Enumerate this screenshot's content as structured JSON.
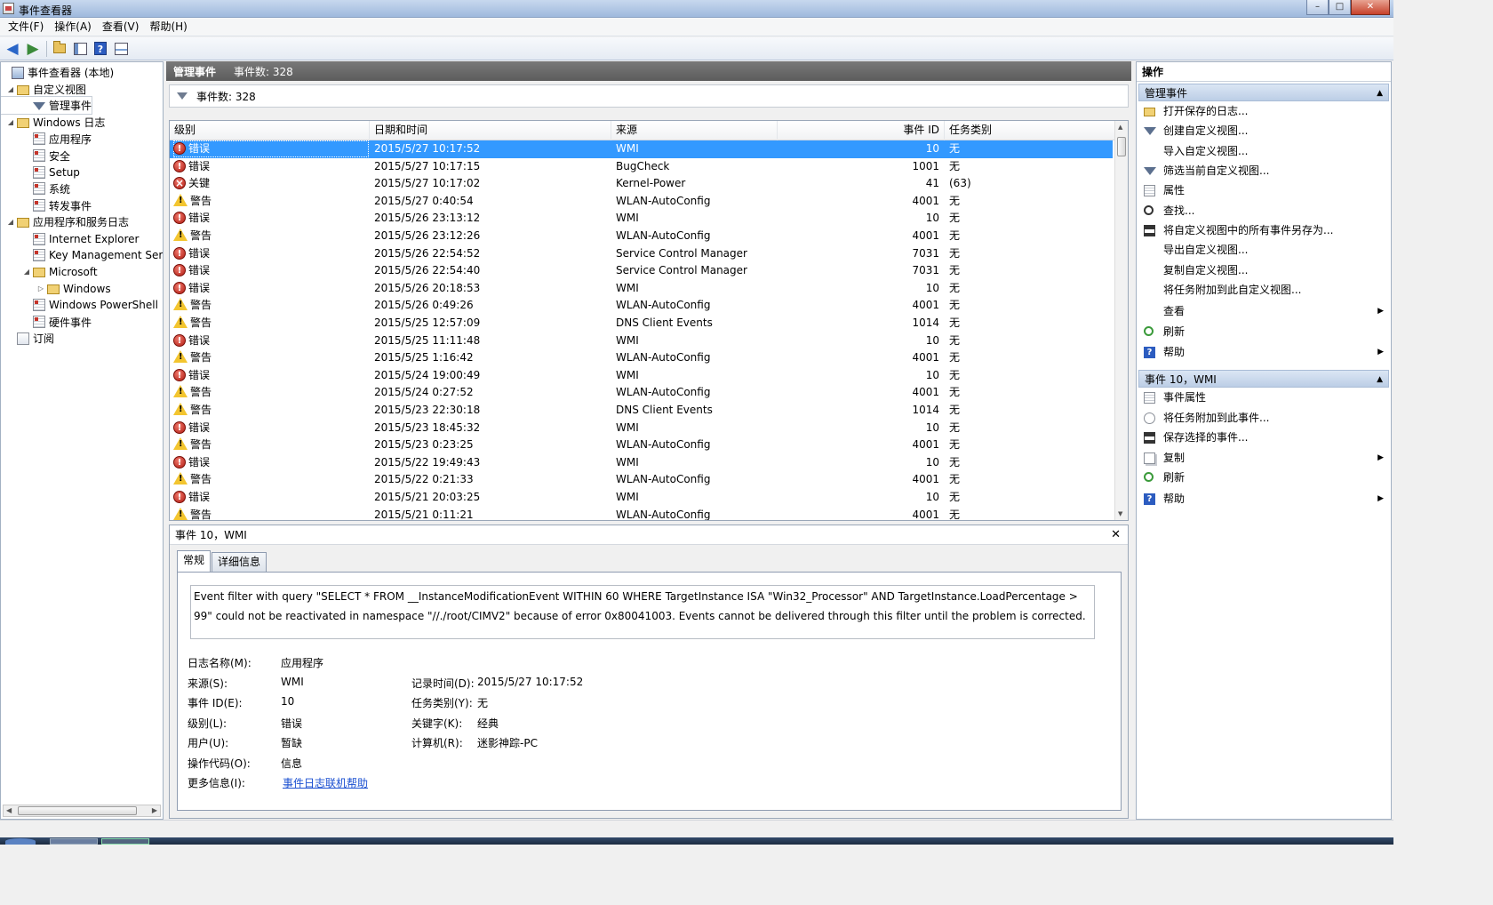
{
  "window": {
    "title": "事件查看器",
    "buttons": {
      "minimize": "–",
      "maximize": "□",
      "close": "✕"
    }
  },
  "menu": [
    {
      "label": "文件(F)"
    },
    {
      "label": "操作(A)"
    },
    {
      "label": "查看(V)"
    },
    {
      "label": "帮助(H)"
    }
  ],
  "toolbar": {
    "back_icon": "arrow-left",
    "forward_icon": "arrow-right",
    "help_glyph": "?"
  },
  "tree": {
    "items": [
      {
        "label": "事件查看器 (本地)",
        "icon": "computer-icon",
        "twisty": ""
      },
      {
        "label": "自定义视图",
        "icon": "folder-icon",
        "twisty": "◢"
      },
      {
        "label": "管理事件",
        "icon": "filter-icon",
        "twisty": ""
      },
      {
        "label": "Windows 日志",
        "icon": "folder-icon",
        "twisty": "◢"
      },
      {
        "label": "应用程序",
        "icon": "log-icon",
        "twisty": ""
      },
      {
        "label": "安全",
        "icon": "log-icon",
        "twisty": ""
      },
      {
        "label": "Setup",
        "icon": "log-icon",
        "twisty": ""
      },
      {
        "label": "系统",
        "icon": "log-icon",
        "twisty": ""
      },
      {
        "label": "转发事件",
        "icon": "log-icon",
        "twisty": ""
      },
      {
        "label": "应用程序和服务日志",
        "icon": "folder-icon",
        "twisty": "◢"
      },
      {
        "label": "Internet Explorer",
        "icon": "log-icon",
        "twisty": ""
      },
      {
        "label": "Key Management Serv",
        "icon": "log-icon",
        "twisty": ""
      },
      {
        "label": "Microsoft",
        "icon": "folder-icon",
        "twisty": "◢"
      },
      {
        "label": "Windows",
        "icon": "folder-icon",
        "twisty": "▷"
      },
      {
        "label": "Windows PowerShell",
        "icon": "log-icon",
        "twisty": ""
      },
      {
        "label": "硬件事件",
        "icon": "log-icon",
        "twisty": ""
      },
      {
        "label": "订阅",
        "icon": "subscription-icon",
        "twisty": ""
      }
    ],
    "scroll_thumb_glyph": "III"
  },
  "center": {
    "header_title": "管理事件",
    "header_count": "事件数: 328",
    "filter_text": "事件数: 328",
    "columns": [
      "级别",
      "日期和时间",
      "来源",
      "事件 ID",
      "任务类别"
    ],
    "rows": [
      {
        "level": "错误",
        "level_type": "info",
        "datetime": "2015/5/27 10:17:52",
        "source": "WMI",
        "event_id": "10",
        "task": "无"
      },
      {
        "level": "错误",
        "level_type": "error",
        "datetime": "2015/5/27 10:17:15",
        "source": "BugCheck",
        "event_id": "1001",
        "task": "无"
      },
      {
        "level": "关键",
        "level_type": "critical",
        "datetime": "2015/5/27 10:17:02",
        "source": "Kernel-Power",
        "event_id": "41",
        "task": "(63)"
      },
      {
        "level": "警告",
        "level_type": "warning",
        "datetime": "2015/5/27 0:40:54",
        "source": "WLAN-AutoConfig",
        "event_id": "4001",
        "task": "无"
      },
      {
        "level": "错误",
        "level_type": "error",
        "datetime": "2015/5/26 23:13:12",
        "source": "WMI",
        "event_id": "10",
        "task": "无"
      },
      {
        "level": "警告",
        "level_type": "warning",
        "datetime": "2015/5/26 23:12:26",
        "source": "WLAN-AutoConfig",
        "event_id": "4001",
        "task": "无"
      },
      {
        "level": "错误",
        "level_type": "error",
        "datetime": "2015/5/26 22:54:52",
        "source": "Service Control Manager",
        "event_id": "7031",
        "task": "无"
      },
      {
        "level": "错误",
        "level_type": "error",
        "datetime": "2015/5/26 22:54:40",
        "source": "Service Control Manager",
        "event_id": "7031",
        "task": "无"
      },
      {
        "level": "错误",
        "level_type": "error",
        "datetime": "2015/5/26 20:18:53",
        "source": "WMI",
        "event_id": "10",
        "task": "无"
      },
      {
        "level": "警告",
        "level_type": "warning",
        "datetime": "2015/5/26 0:49:26",
        "source": "WLAN-AutoConfig",
        "event_id": "4001",
        "task": "无"
      },
      {
        "level": "警告",
        "level_type": "warning",
        "datetime": "2015/5/25 12:57:09",
        "source": "DNS Client Events",
        "event_id": "1014",
        "task": "无"
      },
      {
        "level": "错误",
        "level_type": "error",
        "datetime": "2015/5/25 11:11:48",
        "source": "WMI",
        "event_id": "10",
        "task": "无"
      },
      {
        "level": "警告",
        "level_type": "warning",
        "datetime": "2015/5/25 1:16:42",
        "source": "WLAN-AutoConfig",
        "event_id": "4001",
        "task": "无"
      },
      {
        "level": "错误",
        "level_type": "error",
        "datetime": "2015/5/24 19:00:49",
        "source": "WMI",
        "event_id": "10",
        "task": "无"
      },
      {
        "level": "警告",
        "level_type": "warning",
        "datetime": "2015/5/24 0:27:52",
        "source": "WLAN-AutoConfig",
        "event_id": "4001",
        "task": "无"
      },
      {
        "level": "警告",
        "level_type": "warning",
        "datetime": "2015/5/23 22:30:18",
        "source": "DNS Client Events",
        "event_id": "1014",
        "task": "无"
      },
      {
        "level": "错误",
        "level_type": "error",
        "datetime": "2015/5/23 18:45:32",
        "source": "WMI",
        "event_id": "10",
        "task": "无"
      },
      {
        "level": "警告",
        "level_type": "warning",
        "datetime": "2015/5/23 0:23:25",
        "source": "WLAN-AutoConfig",
        "event_id": "4001",
        "task": "无"
      },
      {
        "level": "错误",
        "level_type": "error",
        "datetime": "2015/5/22 19:49:43",
        "source": "WMI",
        "event_id": "10",
        "task": "无"
      },
      {
        "level": "警告",
        "level_type": "warning",
        "datetime": "2015/5/22 0:21:33",
        "source": "WLAN-AutoConfig",
        "event_id": "4001",
        "task": "无"
      },
      {
        "level": "错误",
        "level_type": "error",
        "datetime": "2015/5/21 20:03:25",
        "source": "WMI",
        "event_id": "10",
        "task": "无"
      },
      {
        "level": "警告",
        "level_type": "warning",
        "datetime": "2015/5/21 0:11:21",
        "source": "WLAN-AutoConfig",
        "event_id": "4001",
        "task": "无"
      }
    ]
  },
  "detail": {
    "title": "事件 10，WMI",
    "close_glyph": "✕",
    "tabs": [
      "常规",
      "详细信息"
    ],
    "description": "Event filter with query \"SELECT * FROM __InstanceModificationEvent WITHIN 60 WHERE TargetInstance ISA \"Win32_Processor\" AND TargetInstance.LoadPercentage > 99\" could not be reactivated in namespace \"//./root/CIMV2\" because of error 0x80041003. Events cannot be delivered through this filter until the problem is corrected.",
    "left_props": [
      {
        "label": "日志名称(M):",
        "value": "应用程序"
      },
      {
        "label": "来源(S):",
        "value": "WMI"
      },
      {
        "label": "事件 ID(E):",
        "value": "10"
      },
      {
        "label": "级别(L):",
        "value": "错误"
      },
      {
        "label": "用户(U):",
        "value": "暂缺"
      },
      {
        "label": "操作代码(O):",
        "value": "信息"
      },
      {
        "label": "更多信息(I):",
        "value": "事件日志联机帮助"
      }
    ],
    "right_props": [
      {
        "label": "记录时间(D):",
        "value": "2015/5/27 10:17:52"
      },
      {
        "label": "任务类别(Y):",
        "value": "无"
      },
      {
        "label": "关键字(K):",
        "value": "经典"
      },
      {
        "label": "计算机(R):",
        "value": "迷影神踪-PC"
      }
    ]
  },
  "actions": {
    "title": "操作",
    "sections": [
      {
        "title": "管理事件",
        "items": [
          {
            "label": "打开保存的日志...",
            "icon": "open-icon",
            "submenu": false
          },
          {
            "label": "创建自定义视图...",
            "icon": "filter-icon",
            "submenu": false
          },
          {
            "label": "导入自定义视图...",
            "icon": "",
            "submenu": false
          },
          {
            "label": "筛选当前自定义视图...",
            "icon": "filter-icon",
            "submenu": false
          },
          {
            "label": "属性",
            "icon": "properties-icon",
            "submenu": false
          },
          {
            "label": "查找...",
            "icon": "find-icon",
            "submenu": false
          },
          {
            "label": "将自定义视图中的所有事件另存为...",
            "icon": "save-icon",
            "submenu": false
          },
          {
            "label": "导出自定义视图...",
            "icon": "",
            "submenu": false
          },
          {
            "label": "复制自定义视图...",
            "icon": "",
            "submenu": false
          },
          {
            "label": "将任务附加到此自定义视图...",
            "icon": "",
            "submenu": false
          },
          {
            "label": "查看",
            "icon": "",
            "submenu": true
          },
          {
            "label": "刷新",
            "icon": "refresh-icon",
            "submenu": false
          },
          {
            "label": "帮助",
            "icon": "help-icon",
            "submenu": true
          }
        ]
      },
      {
        "title": "事件 10，WMI",
        "items": [
          {
            "label": "事件属性",
            "icon": "properties-icon",
            "submenu": false
          },
          {
            "label": "将任务附加到此事件...",
            "icon": "task-icon",
            "submenu": false
          },
          {
            "label": "保存选择的事件...",
            "icon": "save-icon",
            "submenu": false
          },
          {
            "label": "复制",
            "icon": "copy-icon",
            "submenu": true
          },
          {
            "label": "刷新",
            "icon": "refresh-icon",
            "submenu": false
          },
          {
            "label": "帮助",
            "icon": "help-icon",
            "submenu": true
          }
        ]
      }
    ]
  }
}
